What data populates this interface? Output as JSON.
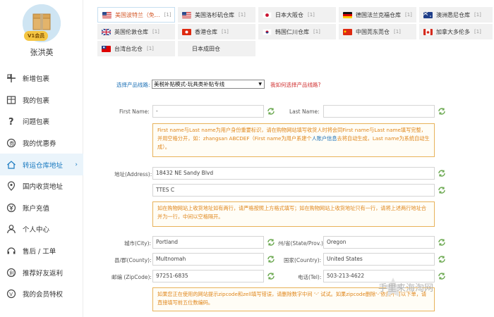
{
  "user": {
    "name": "张洪英",
    "vip_label": "V1会员"
  },
  "nav": {
    "items": [
      {
        "label": "新增包裹",
        "icon": "add-package-icon"
      },
      {
        "label": "我的包裹",
        "icon": "package-box-icon"
      },
      {
        "label": "问题包裹",
        "icon": "question-mark-icon"
      },
      {
        "label": "我的优惠券",
        "icon": "coupon-icon"
      },
      {
        "label": "转运仓库地址",
        "icon": "home-icon",
        "active": true
      },
      {
        "label": "国内收货地址",
        "icon": "location-pin-icon"
      },
      {
        "label": "账户充值",
        "icon": "yen-icon"
      },
      {
        "label": "个人中心",
        "icon": "user-icon"
      },
      {
        "label": "售后 / 工单",
        "icon": "support-icon"
      },
      {
        "label": "推荐好友返利",
        "icon": "rebate-icon"
      },
      {
        "label": "我的会员特权",
        "icon": "member-privilege-icon"
      }
    ],
    "chevron": "›"
  },
  "tabs": [
    {
      "label": "美国波特兰（免...",
      "count": "[1]",
      "flag": "us",
      "active": true
    },
    {
      "label": "美国洛杉矶仓库",
      "count": "[1]",
      "flag": "us"
    },
    {
      "label": "日本大阪仓",
      "count": "[1]",
      "flag": "jp"
    },
    {
      "label": "德国法兰克福仓库",
      "count": "[1]",
      "flag": "de"
    },
    {
      "label": "澳洲悉尼仓库",
      "count": "[1]",
      "flag": "au"
    },
    {
      "label": "英国伦敦仓库",
      "count": "[1]",
      "flag": "uk"
    },
    {
      "label": "香港仓库",
      "count": "[1]",
      "flag": "hk"
    },
    {
      "label": "韩国仁川仓库",
      "count": "[1]",
      "flag": "kr"
    },
    {
      "label": "中国莞东莞仓",
      "count": "[1]",
      "flag": "cn"
    },
    {
      "label": "加拿大多伦多",
      "count": "[1]",
      "flag": "ca"
    },
    {
      "label": "台湾台北仓",
      "count": "[1]",
      "flag": "tw"
    },
    {
      "label": "日本成田仓",
      "count": "",
      "flag": "none"
    }
  ],
  "form": {
    "product_line_label": "选择产品线路:",
    "product_line_value": "美税补贴模式-玩具类补贴专线",
    "product_line_help": "我如何选择产品线路?",
    "first_name_label": "First Name:",
    "first_name_value": "-",
    "last_name_label": "Last Name:",
    "last_name_value": "",
    "name_note_a": "First name与Last name为用户身份重要标识，请在购物网站填写收货人时将会同First name与Last name填写完整，并用空格分开，如：zhangsan ABCDEF（First name为用户系建个",
    "name_note_link": "人账户信息",
    "name_note_b": "去将自动生成，Last name为系统自动生成）。",
    "address_label": "地址(Address):",
    "address1_value": "18432 NE Sandy Blvd",
    "address2_value": "TTES C",
    "address_note": "如在购物网站上收货地址如有两行，请严格按照上方格式填写；如在购物网站上收货地址只有一行，请将上述两行地址合并为一行，中间以空格隔开。",
    "city_label": "城市(City):",
    "city_value": "Portland",
    "state_label": "州/省(State/Prov.):",
    "state_value": "Oregon",
    "county_label": "县/郡(County):",
    "county_value": "Multnomah",
    "country_label": "国家(Country):",
    "country_value": "United States",
    "zip_label": "邮编 (ZipCode):",
    "zip_value": "97251-6835",
    "tel_label": "电话(Tel):",
    "tel_value": "503-213-4622",
    "zip_note": "如果您正在使用的网站提示zipcode和zell填写错误，请删除数字中间 ‘-’ 试试。如果zipcode删除‘-’依然不可以下单，请直接填写前五位数编码。"
  },
  "watermark": "手里来海淘网",
  "colors": {
    "accent_blue": "#1a7ac0",
    "note_orange": "#e0871c",
    "active_tab_text": "#d45a2a"
  }
}
